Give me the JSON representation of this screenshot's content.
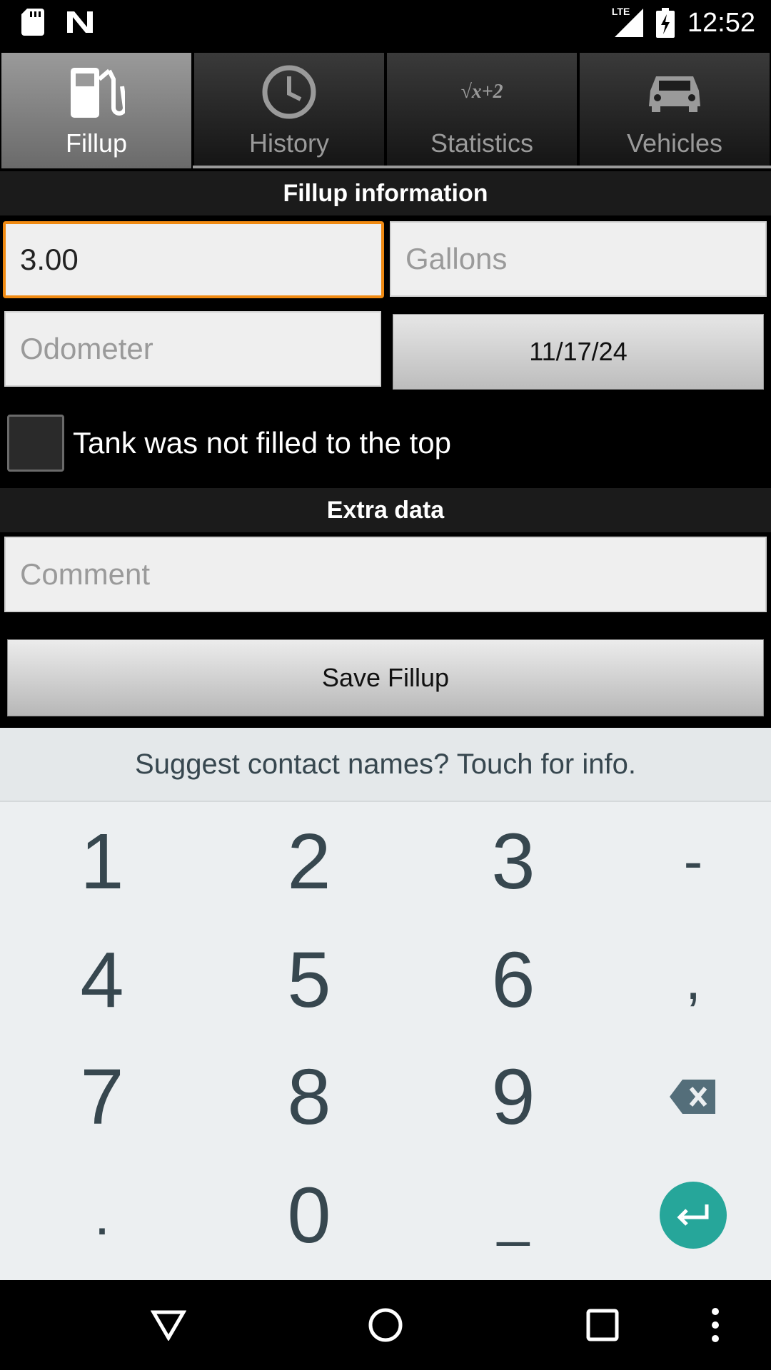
{
  "status_bar": {
    "time": "12:52",
    "network": "LTE",
    "icons": [
      "sd-card-icon",
      "n-logo-icon",
      "signal-icon",
      "battery-charging-icon"
    ]
  },
  "tabs": [
    {
      "label": "Fillup",
      "icon": "fuel-pump-icon",
      "active": true
    },
    {
      "label": "History",
      "icon": "clock-icon",
      "active": false
    },
    {
      "label": "Statistics",
      "icon": "sqrt-formula-icon",
      "active": false,
      "icon_text": "√x+2"
    },
    {
      "label": "Vehicles",
      "icon": "car-icon",
      "active": false
    }
  ],
  "fillup_section": {
    "header": "Fillup information",
    "price_value": "3.00",
    "gallons_placeholder": "Gallons",
    "odometer_placeholder": "Odometer",
    "date": "11/17/24",
    "partial_fill_label": "Tank was not filled to the top",
    "partial_fill_checked": false
  },
  "extra_section": {
    "header": "Extra data",
    "comment_placeholder": "Comment"
  },
  "save_label": "Save Fillup",
  "keyboard": {
    "suggestion": "Suggest contact names? Touch for info.",
    "keys": [
      "1",
      "2",
      "3",
      "-",
      "4",
      "5",
      "6",
      ",",
      "7",
      "8",
      "9",
      "⌫",
      ".",
      "0",
      "_",
      "↵"
    ],
    "accent_color": "#26a69a"
  },
  "colors": {
    "focus_border": "#f08a12"
  }
}
